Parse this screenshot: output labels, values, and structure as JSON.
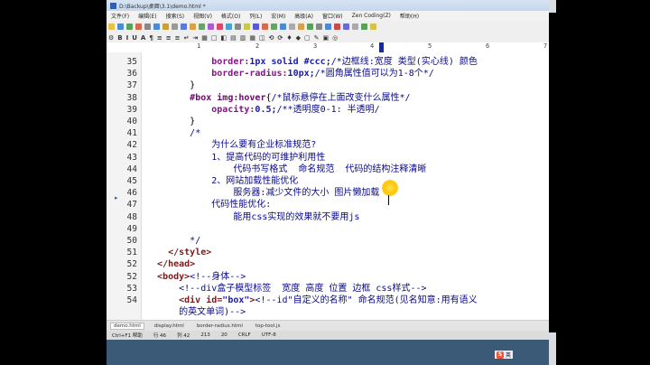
{
  "window": {
    "title": "D:\\Backup\\桌面\\3.1\\demo.html *"
  },
  "menu": [
    "文件(F)",
    "编辑(E)",
    "搜索(S)",
    "视图(V)",
    "格式(O)",
    "列(L)",
    "宏(M)",
    "高级(A)",
    "窗口(W)",
    "Zen Coding(Z)",
    "帮助(H)"
  ],
  "ruler": {
    "marks": [
      "1",
      "2",
      "3",
      "4",
      "5",
      "6",
      "7"
    ]
  },
  "code_lines": [
    {
      "n": "35",
      "segments": [
        {
          "t": "            "
        },
        {
          "t": "border:",
          "c": "kw"
        },
        {
          "t": "1px solid #ccc;",
          "c": "val"
        },
        {
          "t": "/*边框线:宽度 类型(实心线) 颜色",
          "c": "cm"
        }
      ]
    },
    {
      "n": "36",
      "segments": [
        {
          "t": "            "
        },
        {
          "t": "border-radius:",
          "c": "kw"
        },
        {
          "t": "10px;",
          "c": "val"
        },
        {
          "t": "/*圆角属性值可以为1-8个*/",
          "c": "cm"
        }
      ]
    },
    {
      "n": "37",
      "segments": [
        {
          "t": "        }"
        }
      ]
    },
    {
      "n": "38",
      "segments": [
        {
          "t": "        "
        },
        {
          "t": "#box img:hover",
          "c": "sel"
        },
        {
          "t": "{"
        },
        {
          "t": "/*鼠标悬停在上面改变什么属性*/",
          "c": "cm"
        }
      ]
    },
    {
      "n": "39",
      "segments": [
        {
          "t": "            "
        },
        {
          "t": "opacity:",
          "c": "kw"
        },
        {
          "t": "0.5;",
          "c": "val"
        },
        {
          "t": "/**透明度0-1: 半透明/",
          "c": "cm"
        }
      ]
    },
    {
      "n": "40",
      "segments": [
        {
          "t": "        }"
        }
      ]
    },
    {
      "n": "41",
      "segments": [
        {
          "t": "        "
        },
        {
          "t": "/*",
          "c": "cm"
        }
      ]
    },
    {
      "n": "42",
      "segments": [
        {
          "t": "            "
        },
        {
          "t": "为什么要有企业标准规范?",
          "c": "cm"
        }
      ]
    },
    {
      "n": "43",
      "segments": [
        {
          "t": "            "
        },
        {
          "t": "1、提高代码的可维护利用性",
          "c": "cm"
        }
      ]
    },
    {
      "n": "44",
      "segments": [
        {
          "t": "                "
        },
        {
          "t": "代码书写格式  命名规范  代码的结构注释清晰",
          "c": "cm"
        }
      ]
    },
    {
      "n": "45",
      "segments": [
        {
          "t": "            "
        },
        {
          "t": "2、网站加载性能优化",
          "c": "cm"
        }
      ]
    },
    {
      "n": "46",
      "segments": [
        {
          "t": "                "
        },
        {
          "t": "服务器:减少文件的大小 图片懒加载",
          "c": "cm"
        }
      ]
    },
    {
      "n": "47",
      "segments": [
        {
          "t": "            "
        },
        {
          "t": "代码性能优化:",
          "c": "cm"
        }
      ]
    },
    {
      "n": "48",
      "segments": [
        {
          "t": "                "
        },
        {
          "t": "能用css实现的效果就不要用js",
          "c": "cm"
        }
      ]
    },
    {
      "n": "49",
      "segments": [
        {
          "t": "            "
        }
      ]
    },
    {
      "n": "50",
      "segments": [
        {
          "t": "        "
        },
        {
          "t": "*/",
          "c": "cm"
        }
      ]
    },
    {
      "n": "51",
      "segments": [
        {
          "t": "    "
        },
        {
          "t": "</style>",
          "c": "tag"
        }
      ]
    },
    {
      "n": "52",
      "segments": [
        {
          "t": "  "
        },
        {
          "t": "</head>",
          "c": "tag"
        }
      ]
    },
    {
      "n": "52",
      "segments": [
        {
          "t": "  "
        },
        {
          "t": "<body>",
          "c": "tag"
        },
        {
          "t": "<!--身体-->",
          "c": "cm"
        }
      ]
    },
    {
      "n": "53",
      "segments": [
        {
          "t": "      "
        },
        {
          "t": "<!--div盒子模型标签  宽度 高度 位置 边框 css样式-->",
          "c": "cm"
        }
      ]
    },
    {
      "n": "54",
      "segments": [
        {
          "t": "      "
        },
        {
          "t": "<div ",
          "c": "tag"
        },
        {
          "t": "id=",
          "c": "attr"
        },
        {
          "t": "\"box\"",
          "c": "str"
        },
        {
          "t": ">",
          "c": "tag"
        },
        {
          "t": "<!--id\"自定义的名称\" 命名规范(见名知意:用有语义",
          "c": "cm"
        }
      ]
    },
    {
      "n": "",
      "segments": [
        {
          "t": "      "
        },
        {
          "t": "的英文单词)-->",
          "c": "cm"
        }
      ]
    }
  ],
  "tabs": [
    "demo.html",
    "display.html",
    "border-radius.html",
    "top-tool.js"
  ],
  "status": [
    "Ctrl+F1 帮助",
    "行 46",
    "列 42",
    "213",
    "20",
    "CRLF",
    "UTF-8"
  ],
  "ime_label": "英"
}
